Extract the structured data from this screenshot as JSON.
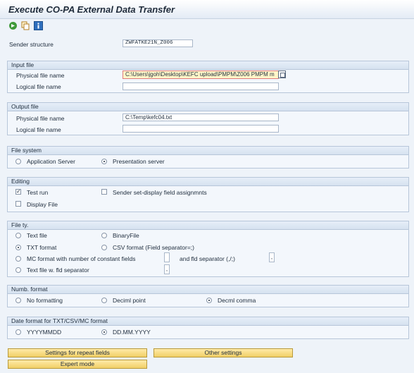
{
  "window": {
    "title": "Execute CO-PA External Data Transfer"
  },
  "toolbar": {
    "icons": [
      "execute-icon",
      "copy-icon",
      "info-icon"
    ]
  },
  "sender": {
    "label": "Sender structure",
    "value": "ZWFATKE21N_Z006"
  },
  "input_file": {
    "title": "Input file",
    "physical_label": "Physical file name",
    "physical_value": "C:\\Users\\jgoh\\Desktop\\KEFC upload\\PMPM\\Z006 PMPM m",
    "logical_label": "Logical file name",
    "logical_value": ""
  },
  "output_file": {
    "title": "Output file",
    "physical_label": "Physical file name",
    "physical_value": "C:\\Temp\\kefc04.txt",
    "logical_label": "Logical file name",
    "logical_value": ""
  },
  "file_system": {
    "title": "File system",
    "app_server": "Application Server",
    "pres_server": "Presentation server"
  },
  "editing": {
    "title": "Editing",
    "test_run": "Test run",
    "sender_set": "Sender set-display field assignmnts",
    "display_file": "Display File"
  },
  "file_type": {
    "title": "File ty.",
    "text_file": "Text file",
    "binary_file": "BinaryFile",
    "txt_format": "TXT format",
    "csv_format": "CSV format (Field separator=;)",
    "mc_format": "MC format with number of constant fields",
    "fld_separator": "and fld separator (,/;)",
    "fld_sep_value": ",",
    "text_wfld": "Text file w. fld separator",
    "text_wfld_value": ","
  },
  "numb_format": {
    "title": "Numb. format",
    "no_formatting": "No formatting",
    "decimal_point": "Deciml point",
    "decimal_comma": "Decml comma"
  },
  "date_format": {
    "title": "Date format for TXT/CSV/MC format",
    "yyyymmdd": "YYYYMMDD",
    "ddmmyyyy": "DD.MM.YYYY"
  },
  "buttons": {
    "repeat_fields": "Settings for repeat fields",
    "other_settings": "Other settings",
    "expert_mode": "Expert mode"
  },
  "colors": {
    "button": "#f1cf66",
    "highlight_field": "#fff6c8",
    "group_bg": "#f3f7fc"
  }
}
